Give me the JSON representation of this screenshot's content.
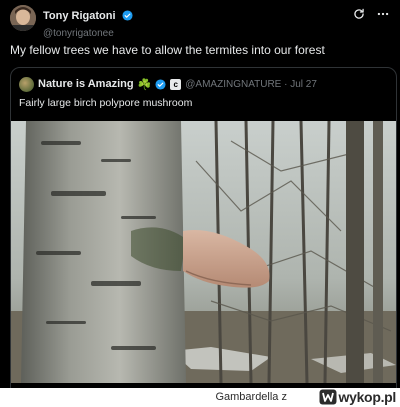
{
  "tweet": {
    "author_name": "Tony Rigatoni",
    "handle": "@tonyrigatonee",
    "text": "My fellow trees we have to allow the termites into our forest"
  },
  "quoted_tweet": {
    "author_name": "Nature is Amazing",
    "emoji": "☘️",
    "handle_date": "@AMAZINGNATURE · Jul 27",
    "text": "Fairly large birch polypore mushroom"
  },
  "icons": {
    "verified": "verified-badge-icon",
    "refresh": "refresh-icon",
    "more": "more-icon",
    "affiliate": "affiliate-badge-icon",
    "wykop": "wykop-logo-icon"
  },
  "footer": {
    "username": "Gambardella",
    "separator": "z",
    "brand": "wykop.pl"
  },
  "colors": {
    "background": "#000000",
    "text": "#e7e9ea",
    "secondary_text": "#71767b",
    "verified": "#1d9bf0",
    "border": "#2f3336"
  }
}
